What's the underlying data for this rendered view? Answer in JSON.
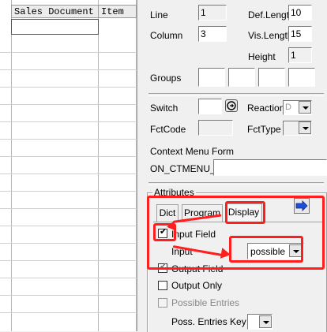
{
  "table": {
    "columns": [
      "Sales Document",
      "Item"
    ]
  },
  "properties": {
    "line_label": "Line",
    "line_value": "1",
    "def_length_label": "Def.Lengt",
    "def_length_value": "10",
    "column_label": "Column",
    "column_value": "3",
    "vis_length_label": "Vis.Length",
    "vis_length_value": "15",
    "height_label": "Height",
    "height_value": "1",
    "groups_label": "Groups",
    "switch_label": "Switch",
    "reaction_label": "Reaction",
    "reaction_value": "D",
    "fctcode_label": "FctCode",
    "fcttype_label": "FctType",
    "context_menu_label": "Context Menu Form",
    "context_menu_prefix": "ON_CTMENU_"
  },
  "attributes": {
    "title": "Attributes",
    "tabs": [
      "Dict",
      "Program",
      "Display"
    ],
    "active_tab": "Display",
    "input_field_label": "Input Field",
    "input_field_checked": true,
    "input_label": "Input",
    "input_value": "possible",
    "output_field_label": "Output Field",
    "output_field_checked": true,
    "output_only_label": "Output Only",
    "possible_entries_label": "Possible Entries",
    "poss_entries_key_label": "Poss. Entries Key"
  },
  "colors": {
    "highlight": "#ff1e1e",
    "panel_bg": "#f0f0f0"
  }
}
